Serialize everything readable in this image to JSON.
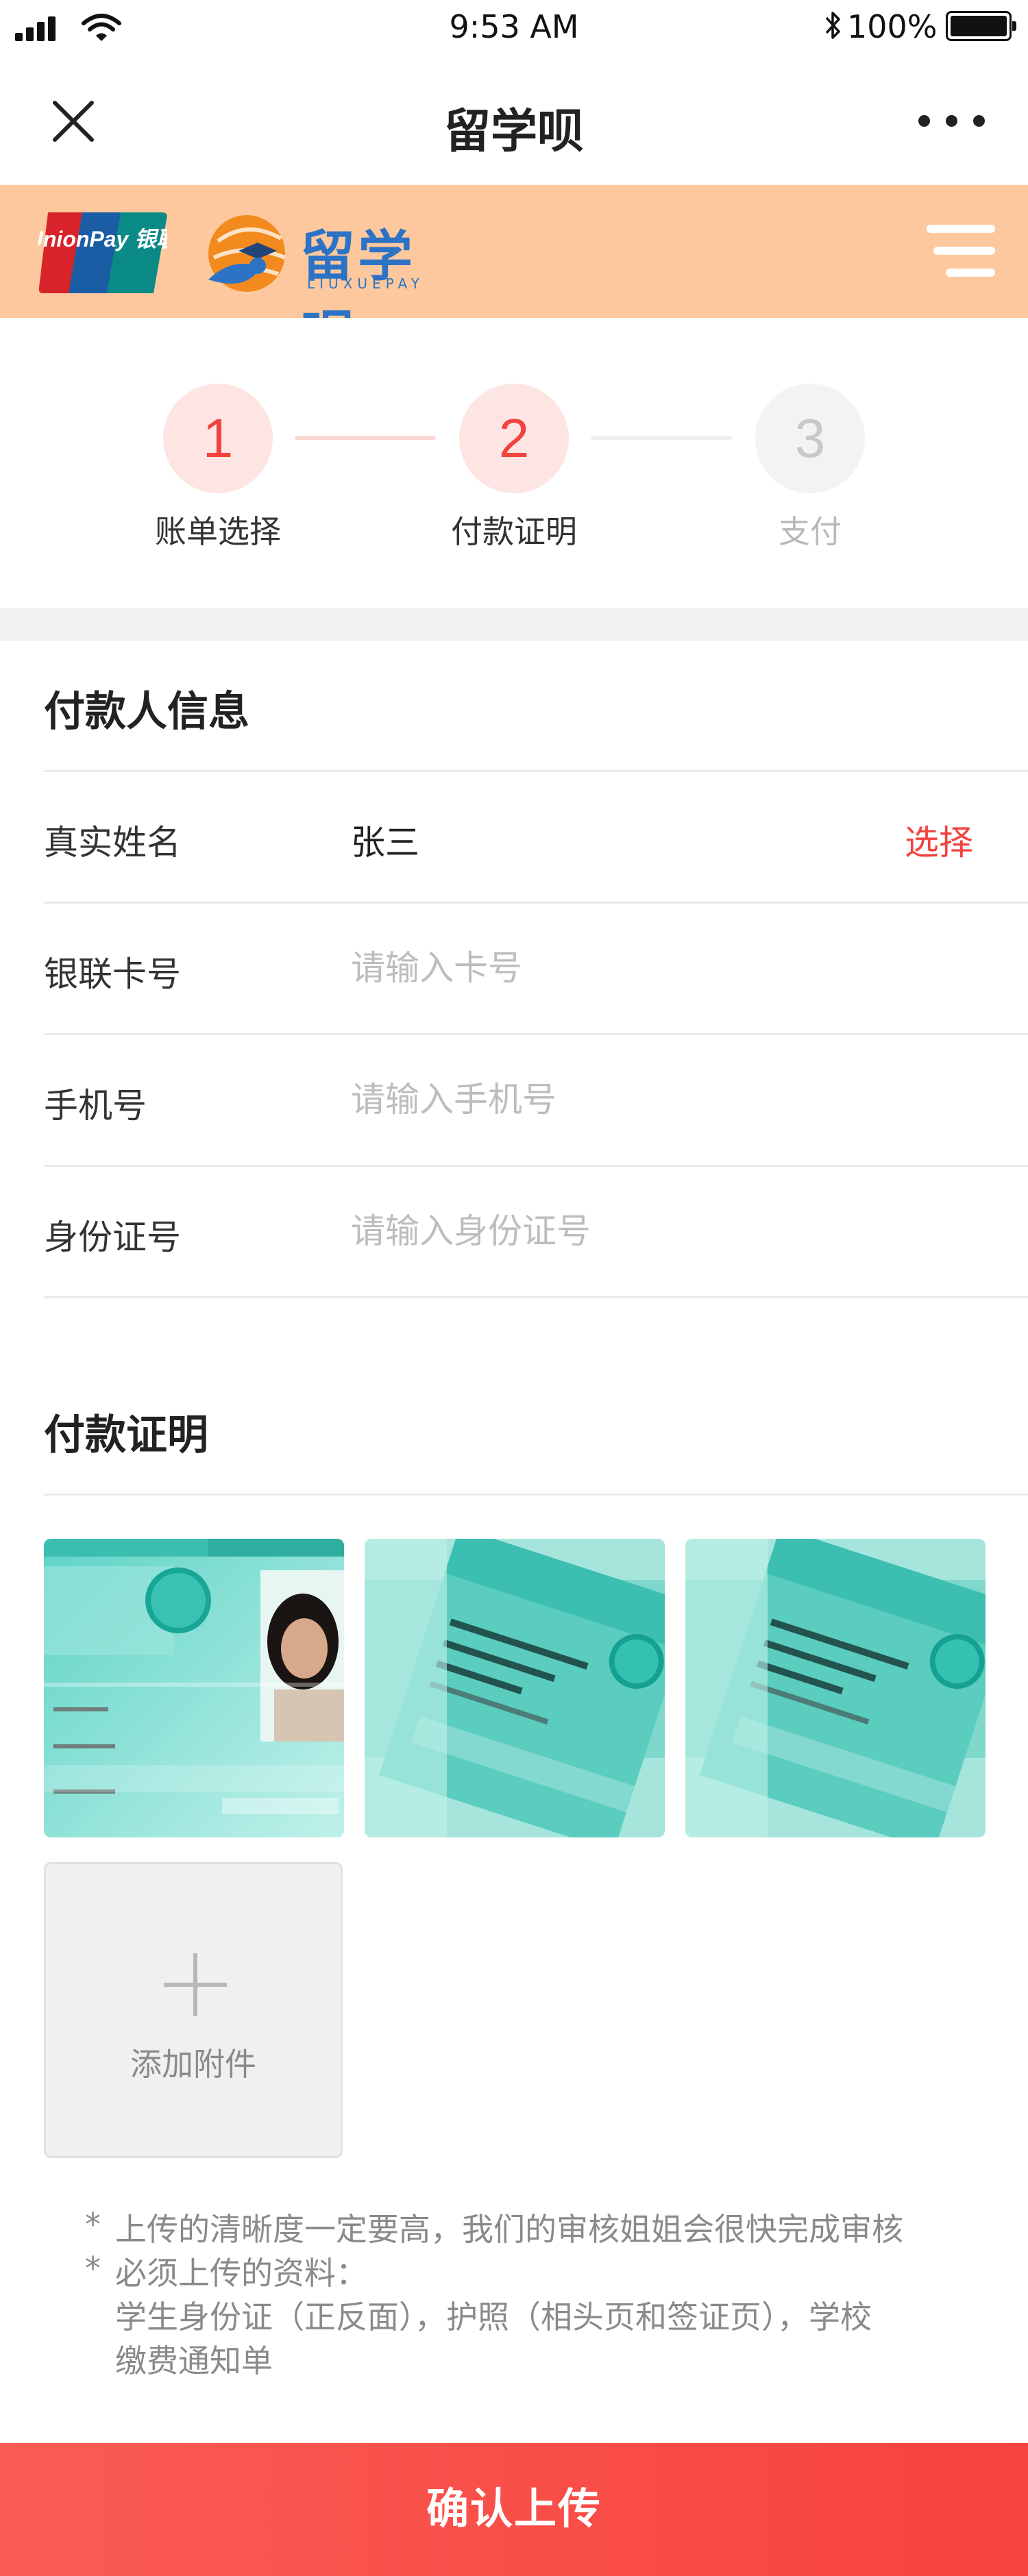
{
  "status_bar": {
    "time": "9:53 AM",
    "battery": "100%"
  },
  "nav": {
    "title": "留学呗"
  },
  "banner": {
    "unionpay_logo": "UnionPay 银联",
    "brand_name": "留学呗",
    "brand_sub": "LIUXUEPAY"
  },
  "steps": [
    {
      "number": "1",
      "label": "账单选择",
      "state": "active"
    },
    {
      "number": "2",
      "label": "付款证明",
      "state": "active"
    },
    {
      "number": "3",
      "label": "支付",
      "state": "todo"
    }
  ],
  "payer_section": {
    "title": "付款人信息",
    "name": {
      "label": "真实姓名",
      "value": "张三",
      "action": "选择"
    },
    "card": {
      "label": "银联卡号",
      "placeholder": "请输入卡号",
      "value": ""
    },
    "phone": {
      "label": "手机号",
      "placeholder": "请输入手机号",
      "value": ""
    },
    "id_number": {
      "label": "身份证号",
      "placeholder": "请输入身份证号",
      "value": ""
    }
  },
  "proof_section": {
    "title": "付款证明",
    "attachments": [
      {
        "kind": "student-id-card-photo"
      },
      {
        "kind": "student-id-card-photo"
      },
      {
        "kind": "student-id-card-photo"
      }
    ],
    "add_label": "添加附件"
  },
  "notes": {
    "line1": "上传的清晰度一定要高，我们的审核姐姐会很快完成审核",
    "line2": "必须上传的资料：",
    "line3": "学生身份证（正反面），护照（相头页和签证页），学校",
    "line4": "缴费通知单",
    "bullet": "*"
  },
  "submit_label": "确认上传",
  "colors": {
    "accent": "#f2433e",
    "banner": "#fdc89d",
    "brand_blue": "#2c73c6"
  },
  "icons": [
    "signal-icon",
    "wifi-icon",
    "bluetooth-icon",
    "battery-icon",
    "close-icon",
    "more-icon",
    "menu-icon",
    "plus-icon"
  ]
}
